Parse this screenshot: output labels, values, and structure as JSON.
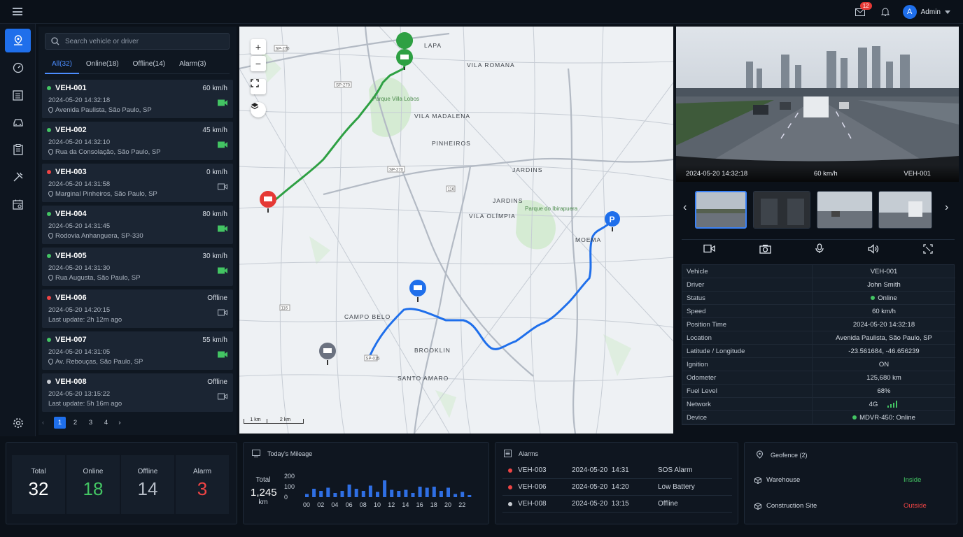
{
  "topbar": {
    "mail_badge": "12",
    "user_initial": "A",
    "user_name": "Admin"
  },
  "search": {
    "placeholder": "Search vehicle or driver"
  },
  "tabs": [
    {
      "label": "All(32)"
    },
    {
      "label": "Online(18)"
    },
    {
      "label": "Offline(14)"
    },
    {
      "label": "Alarm(3)"
    }
  ],
  "vehicles": [
    {
      "id": "VEH-001",
      "speed": "60 km/h",
      "time": "2024-05-20 14:32:18",
      "loc": "Avenida Paulista, São Paulo, SP",
      "status": "online"
    },
    {
      "id": "VEH-002",
      "speed": "45 km/h",
      "time": "2024-05-20 14:32:10",
      "loc": "Rua da Consolação, São Paulo, SP",
      "status": "online"
    },
    {
      "id": "VEH-003",
      "speed": "0 km/h",
      "time": "2024-05-20 14:31:58",
      "loc": "Marginal Pinheiros, São Paulo, SP",
      "status": "alarm"
    },
    {
      "id": "VEH-004",
      "speed": "80 km/h",
      "time": "2024-05-20 14:31:45",
      "loc": "Rodovia Anhanguera, SP-330",
      "status": "online"
    },
    {
      "id": "VEH-005",
      "speed": "30 km/h",
      "time": "2024-05-20 14:31:30",
      "loc": "Rua Augusta, São Paulo, SP",
      "status": "online"
    },
    {
      "id": "VEH-006",
      "speed": "Offline",
      "time": "2024-05-20 14:20:15",
      "loc": "Last update: 2h 12m ago",
      "status": "alarm"
    },
    {
      "id": "VEH-007",
      "speed": "55 km/h",
      "time": "2024-05-20 14:31:05",
      "loc": "Av. Rebouças, São Paulo, SP",
      "status": "online"
    },
    {
      "id": "VEH-008",
      "speed": "Offline",
      "time": "2024-05-20 13:15:22",
      "loc": "Last update: 5h 16m ago",
      "status": "offline"
    }
  ],
  "pager": {
    "pages": [
      "1",
      "2",
      "3",
      "4"
    ]
  },
  "map": {
    "zoom_in": "+",
    "zoom_out": "−",
    "labels": [
      "LAPA",
      "VILA ROMANA",
      "Parque Villa Lobos",
      "VILA MADALENA",
      "PINHEIROS",
      "JARDINS",
      "JARDINS",
      "VILA OLÍMPIA",
      "Parque do Ibirapuera",
      "MOEMA",
      "CAMPO BELO",
      "BROOKLIN",
      "SANTO AMARO"
    ],
    "roads": [
      "SP-270",
      "SP-270",
      "SP-270",
      "116",
      "116",
      "SP-015"
    ],
    "scale": [
      "1 km",
      "2 km"
    ]
  },
  "video": {
    "time": "2024-05-20 14:32:18",
    "speed": "60 km/h",
    "vehicle": "VEH-001"
  },
  "info": [
    {
      "k": "Vehicle",
      "v": "VEH-001"
    },
    {
      "k": "Driver",
      "v": "John Smith"
    },
    {
      "k": "Status",
      "v": "Online"
    },
    {
      "k": "Speed",
      "v": "60 km/h"
    },
    {
      "k": "Position Time",
      "v": "2024-05-20 14:32:18"
    },
    {
      "k": "Location",
      "v": "Avenida Paulista, São Paulo, SP"
    },
    {
      "k": "Latitude / Longitude",
      "v": "-23.561684, -46.656239"
    },
    {
      "k": "Ignition",
      "v": "ON"
    },
    {
      "k": "Odometer",
      "v": "125,680 km"
    },
    {
      "k": "Fuel Level",
      "v": "68%"
    },
    {
      "k": "Network",
      "v": "4G"
    },
    {
      "k": "Device",
      "v": "MDVR-450: Online"
    }
  ],
  "stats": [
    {
      "label": "Total",
      "value": "32",
      "color": "#ffffff"
    },
    {
      "label": "Online",
      "value": "18",
      "color": "#43c463"
    },
    {
      "label": "Offline",
      "value": "14",
      "color": "#b5bcc6"
    },
    {
      "label": "Alarm",
      "value": "3",
      "color": "#ef4444"
    }
  ],
  "mileage": {
    "title": "Today's Mileage",
    "total_label": "Total",
    "total_value": "1,245",
    "unit": "km",
    "y_ticks": [
      "200",
      "100",
      "0"
    ],
    "x_ticks": [
      "00",
      "02",
      "04",
      "06",
      "08",
      "10",
      "12",
      "14",
      "16",
      "18",
      "20",
      "22"
    ]
  },
  "chart_data": {
    "type": "bar",
    "title": "Today's Mileage",
    "x": [
      "00",
      "01",
      "02",
      "03",
      "04",
      "05",
      "06",
      "07",
      "08",
      "09",
      "10",
      "11",
      "12",
      "13",
      "14",
      "15",
      "16",
      "17",
      "18",
      "19",
      "20",
      "21",
      "22",
      "23"
    ],
    "values": [
      30,
      80,
      60,
      90,
      40,
      60,
      120,
      80,
      60,
      110,
      50,
      160,
      70,
      60,
      70,
      40,
      100,
      90,
      100,
      60,
      90,
      30,
      50,
      20
    ],
    "ylim": [
      0,
      200
    ]
  },
  "alarms": {
    "title": "Alarms",
    "rows": [
      {
        "id": "VEH-003",
        "time": "2024-05-20  14:31",
        "type": "SOS Alarm",
        "color": "#ef4444"
      },
      {
        "id": "VEH-006",
        "time": "2024-05-20  14:20",
        "type": "Low Battery",
        "color": "#ef4444"
      },
      {
        "id": "VEH-008",
        "time": "2024-05-20  13:15",
        "type": "Offline",
        "color": "#c8ccd2"
      }
    ]
  },
  "geofence": {
    "title": "Geofence (2)",
    "rows": [
      {
        "name": "Warehouse",
        "state": "Inside",
        "color": "#43c463"
      },
      {
        "name": "Construction Site",
        "state": "Outside",
        "color": "#ef4444"
      }
    ]
  }
}
